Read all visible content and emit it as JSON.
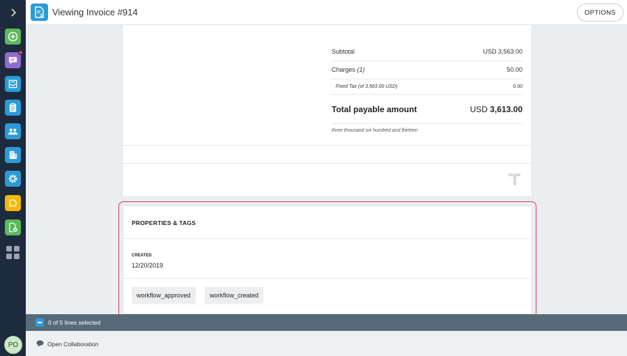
{
  "header": {
    "title": "Viewing Invoice #914",
    "options_label": "OPTIONS"
  },
  "sidebar": {
    "user_initials": "PO",
    "items": [
      {
        "icon": "plus-icon",
        "color": "#5cb85c"
      },
      {
        "icon": "chat-icon",
        "color": "#8e6bd1",
        "notification": true
      },
      {
        "icon": "inbox-icon",
        "color": "#2a9bd8"
      },
      {
        "icon": "clipboard-icon",
        "color": "#2a9bd8"
      },
      {
        "icon": "people-icon",
        "color": "#2a9bd8"
      },
      {
        "icon": "building-icon",
        "color": "#2a9bd8"
      },
      {
        "icon": "gear-icon",
        "color": "#2a9bd8"
      },
      {
        "icon": "puzzle-icon",
        "color": "#f5b800"
      },
      {
        "icon": "document-add-icon",
        "color": "#5cb85c"
      },
      {
        "icon": "apps-grid-icon",
        "color": "#9aa4b2"
      }
    ]
  },
  "invoice": {
    "subtotal_label": "Subtotal",
    "subtotal_value": "USD 3,563.00",
    "charges_label": "Charges",
    "charges_count": "(1)",
    "charges_value": "50.00",
    "fixed_tax_label": "Fixed Tax (of 3,563.00 USD)",
    "fixed_tax_value": "0.00",
    "total_label": "Total payable amount",
    "total_currency": "USD",
    "total_value": "3,613.00",
    "amount_words": "three thousand six hundred and thirteen"
  },
  "properties": {
    "title": "PROPERTIES & TAGS",
    "created_label": "CREATED",
    "created_value": "12/20/2019",
    "tags": [
      "workflow_approved",
      "workflow_created"
    ]
  },
  "selection": {
    "text": "0 of 5 lines selected"
  },
  "footer": {
    "collab_label": "Open Collaboration"
  },
  "colors": {
    "sidebar_bg": "#1e2a3d",
    "accent_blue": "#2a9bd8",
    "highlight_outline": "#d4376e",
    "selection_bar": "#566a78"
  }
}
